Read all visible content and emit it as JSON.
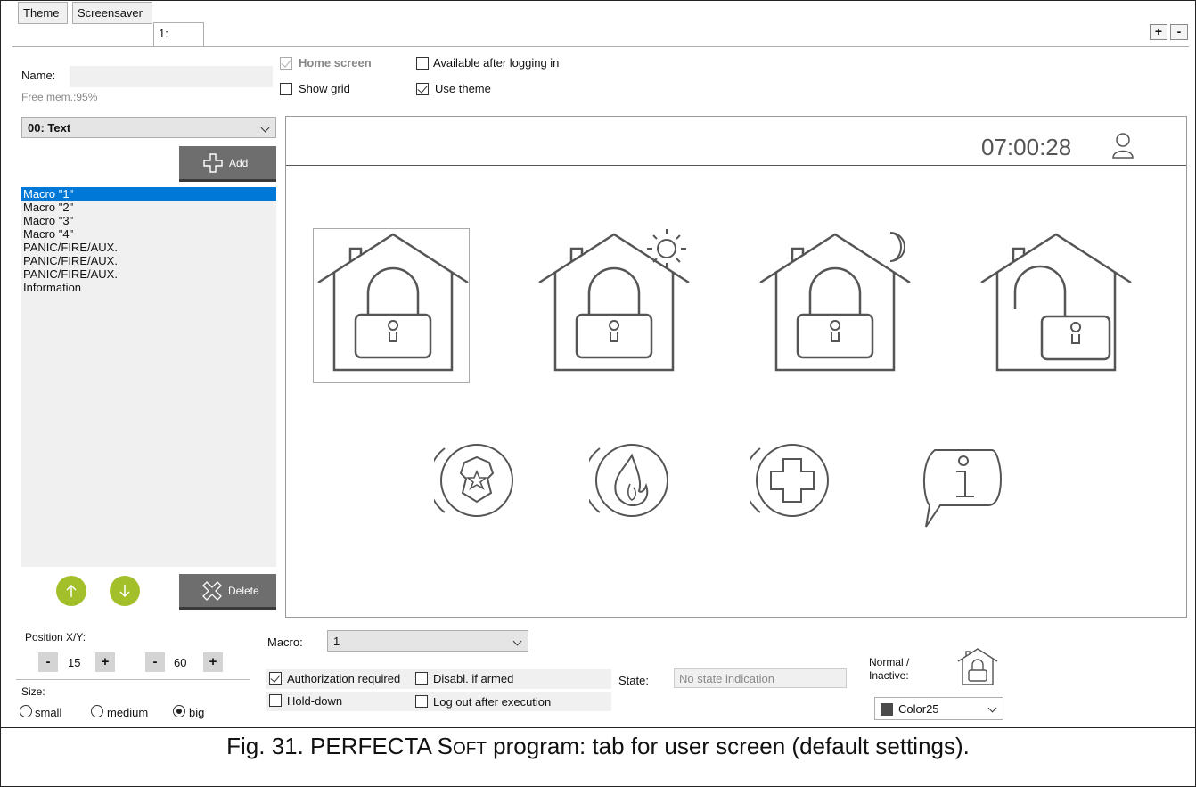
{
  "tabs": [
    "Theme",
    "Screensaver",
    "1:"
  ],
  "window_buttons": {
    "add": "+",
    "remove": "-"
  },
  "name_label": "Name:",
  "name_value": "",
  "free_mem": "Free mem.:95%",
  "checkboxes": {
    "home_screen": {
      "label": "Home screen",
      "checked": true,
      "disabled": true
    },
    "available_after_login": {
      "label": "Available after logging in",
      "checked": false
    },
    "show_grid": {
      "label": "Show grid",
      "checked": false
    },
    "use_theme": {
      "label": "Use theme",
      "checked": true
    }
  },
  "object_select": "00: Text",
  "add_button": "Add",
  "macro_list": [
    "Macro \"1\"",
    "Macro \"2\"",
    "Macro \"3\"",
    "Macro \"4\"",
    "PANIC/FIRE/AUX.",
    "PANIC/FIRE/AUX.",
    "PANIC/FIRE/AUX.",
    "Information"
  ],
  "selected_index": 0,
  "delete_button": "Delete",
  "preview": {
    "clock": "07:00:28",
    "icons_row1": [
      "house-armed-icon",
      "house-day-armed-icon",
      "house-night-armed-icon",
      "house-disarmed-icon"
    ],
    "icons_row2": [
      "police-panic-icon",
      "fire-alarm-icon",
      "medical-aux-icon",
      "information-icon"
    ]
  },
  "position": {
    "label": "Position X/Y:",
    "x": "15",
    "y": "60",
    "minus": "-",
    "plus": "+"
  },
  "size": {
    "label": "Size:",
    "options": [
      "small",
      "medium",
      "big"
    ],
    "selected": "big"
  },
  "macro": {
    "label": "Macro:",
    "value": "1"
  },
  "options": {
    "authorization_required": {
      "label": "Authorization required",
      "checked": true
    },
    "disabl_if_armed": {
      "label": "Disabl. if armed",
      "checked": false
    },
    "hold_down": {
      "label": "Hold-down",
      "checked": false
    },
    "log_out_after_execution": {
      "label": "Log out after execution",
      "checked": false
    }
  },
  "state": {
    "label": "State:",
    "value": "No state indication"
  },
  "normal_inactive": {
    "line1": "Normal /",
    "line2": "Inactive:"
  },
  "color_select": {
    "value": "Color25",
    "swatch": "#4a4a4a"
  },
  "caption": {
    "prefix": "Fig. 31. PERFECTA ",
    "s": "S",
    "oft": "OFT",
    "suffix": " program: tab for user screen (default settings)."
  }
}
